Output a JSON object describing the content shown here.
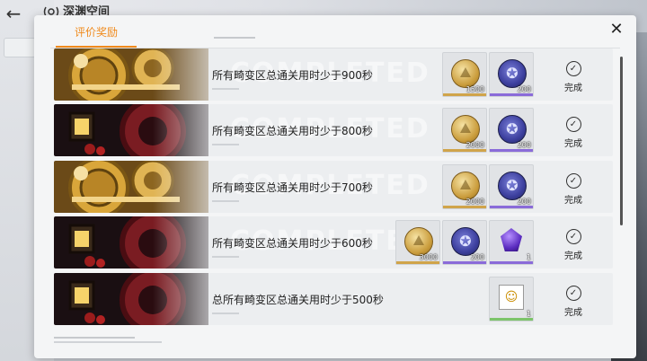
{
  "window": {
    "title": "深渊空间"
  },
  "modal": {
    "active_tab": "评价奖励",
    "close_symbol": "✕",
    "rows": [
      {
        "text": "所有畸变区总通关用时少于900秒",
        "watermark": "COMPLETED",
        "thumb": "gears",
        "items": [
          {
            "kind": "coin",
            "qty": "1500",
            "rarity": "#d0a44a"
          },
          {
            "kind": "medal",
            "qty": "200",
            "rarity": "#8a6bd9"
          }
        ],
        "status": "完成"
      },
      {
        "text": "所有畸变区总通关用时少于800秒",
        "watermark": "COMPLETED",
        "thumb": "lantern",
        "items": [
          {
            "kind": "coin",
            "qty": "2000",
            "rarity": "#d0a44a"
          },
          {
            "kind": "medal",
            "qty": "200",
            "rarity": "#8a6bd9"
          }
        ],
        "status": "完成"
      },
      {
        "text": "所有畸变区总通关用时少于700秒",
        "watermark": "COMPLETED",
        "thumb": "gears",
        "items": [
          {
            "kind": "coin",
            "qty": "2000",
            "rarity": "#d0a44a"
          },
          {
            "kind": "medal",
            "qty": "200",
            "rarity": "#8a6bd9"
          }
        ],
        "status": "完成"
      },
      {
        "text": "所有畸变区总通关用时少于600秒",
        "watermark": "COMPLETED",
        "thumb": "lantern",
        "items": [
          {
            "kind": "coin",
            "qty": "3000",
            "rarity": "#d0a44a"
          },
          {
            "kind": "medal",
            "qty": "200",
            "rarity": "#8a6bd9"
          },
          {
            "kind": "gem",
            "qty": "1",
            "rarity": "#8a6bd9"
          }
        ],
        "status": "完成"
      },
      {
        "text": "总所有畸变区总通关用时少于500秒",
        "watermark": "",
        "thumb": "lantern",
        "items": [
          {
            "kind": "chip",
            "qty": "1",
            "rarity": "#7cc46a"
          }
        ],
        "status": "完成"
      }
    ]
  },
  "icons": {
    "back": "back-arrow-icon",
    "close": "close-icon",
    "check": "check-circle-icon",
    "coin": "gold-coin-icon",
    "medal": "star-medal-icon",
    "gem": "purple-gem-icon",
    "chip": "smiley-chip-icon",
    "coin_glyph": "",
    "medal_glyph": "✪",
    "chip_glyph": "☺",
    "check_glyph": "✓",
    "back_glyph": "←"
  },
  "colors": {
    "accent": "#f08a1c",
    "gold_rarity": "#d0a44a",
    "purple_rarity": "#8a6bd9",
    "green_rarity": "#7cc46a"
  }
}
